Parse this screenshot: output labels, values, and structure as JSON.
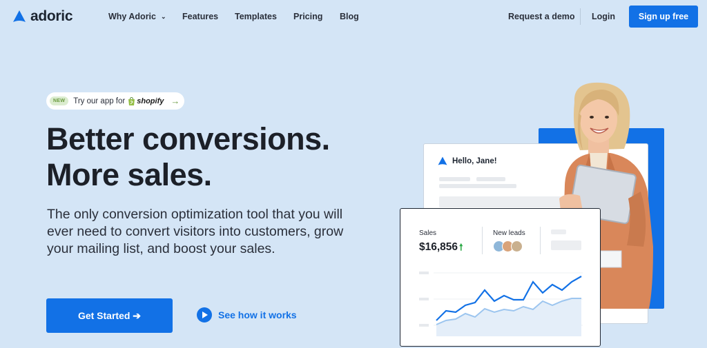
{
  "brand": {
    "name": "adoric",
    "color": "#1271e6"
  },
  "nav": {
    "items": [
      {
        "label": "Why Adoric",
        "has_dropdown": true
      },
      {
        "label": "Features"
      },
      {
        "label": "Templates"
      },
      {
        "label": "Pricing"
      },
      {
        "label": "Blog"
      }
    ],
    "request_demo": "Request a demo",
    "login": "Login",
    "signup": "Sign up free"
  },
  "hero": {
    "pill": {
      "badge": "NEW",
      "text": "Try our app for",
      "platform": "shopify",
      "arrow": "→"
    },
    "headline_line1": "Better conversions.",
    "headline_line2": "More sales.",
    "subtext": "The only conversion optimization tool that you will ever need to convert visitors into customers, grow your mailing list, and boost your sales.",
    "cta": "Get Started ➔",
    "watch": "See how it works"
  },
  "mockup": {
    "greeting": "Hello, Jane!",
    "sales_label": "Sales",
    "sales_value": "$16,856",
    "sales_trend_icon": "arrow-up-icon",
    "leads_label": "New leads",
    "avatar_colors": [
      "#8fb7d9",
      "#d9a37a",
      "#c9b08f"
    ]
  },
  "colors": {
    "background": "#d4e5f6",
    "accent": "#1271e6",
    "trend_up": "#2aa845"
  }
}
